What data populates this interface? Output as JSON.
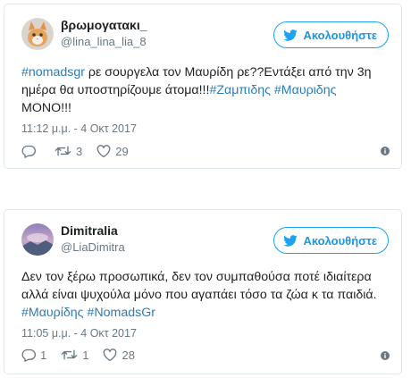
{
  "colors": {
    "accent": "#1da1f2",
    "link": "#2b7bb9",
    "muted": "#697882",
    "border": "#e1e8ed"
  },
  "tweets": [
    {
      "display_name": "βρωμογατακι_",
      "handle": "@lina_lina_lia_8",
      "avatar": "cat-photo-avatar",
      "follow_label": "Ακολουθήστε",
      "text_parts": [
        {
          "text": "#nomadsgr",
          "type": "hashtag"
        },
        {
          "text": " ρε σουργελα τον Μαυρίδη ρε??Εντάξει από την 3η ημέρα θα υποστηρίζουμε άτομα!!!",
          "type": "text"
        },
        {
          "text": "#Ζαμπιδης",
          "type": "hashtag"
        },
        {
          "text": " ",
          "type": "text"
        },
        {
          "text": "#Μαυριδης",
          "type": "hashtag"
        },
        {
          "text": " ΜΟΝΟ!!!",
          "type": "text"
        }
      ],
      "timestamp": "11:12 μ.μ. - 4 Οκτ 2017",
      "replies": "",
      "retweets": "3",
      "likes": "29"
    },
    {
      "display_name": "Dimitralia",
      "handle": "@LiaDimitra",
      "avatar": "landscape-photo-avatar",
      "follow_label": "Ακολουθήστε",
      "text_parts": [
        {
          "text": "Δεν τον ξέρω προσωπικά, δεν τον συμπαθούσα ποτέ ιδιαίτερα αλλά είναι ψυχούλα μόνο που αγαπάει τόσο τα ζώα κ τα παιδιά. ",
          "type": "text"
        },
        {
          "text": "#Μαυρίδης",
          "type": "hashtag"
        },
        {
          "text": " ",
          "type": "text"
        },
        {
          "text": "#NomadsGr",
          "type": "hashtag"
        }
      ],
      "timestamp": "11:05 μ.μ. - 4 Οκτ 2017",
      "replies": "1",
      "retweets": "1",
      "likes": "28"
    }
  ]
}
